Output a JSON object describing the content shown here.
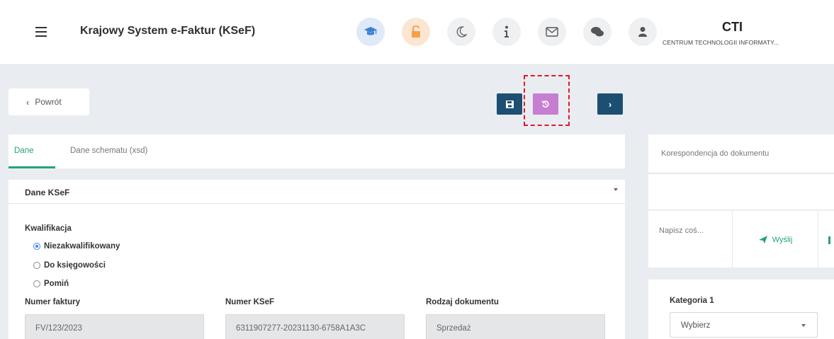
{
  "header": {
    "title": "Krajowy System e-Faktur (KSeF)",
    "icons": [
      "graduation-cap-icon",
      "unlock-icon",
      "moon-icon",
      "info-icon",
      "envelope-icon",
      "comments-icon",
      "user-icon"
    ],
    "brand": {
      "title": "CTI",
      "subtitle": "CENTRUM TECHNOLOGII INFORMATY..."
    }
  },
  "toolbar": {
    "back_label": "Powrót",
    "buttons": [
      "save-icon",
      "restore-icon",
      "next-icon"
    ]
  },
  "tabs": [
    {
      "label": "Dane",
      "active": true
    },
    {
      "label": "Dane schematu (xsd)",
      "active": false
    }
  ],
  "section": {
    "title": "Dane KSeF",
    "qualification_label": "Kwalifikacja",
    "options": [
      {
        "label": "Niezakwalifikowany",
        "selected": true
      },
      {
        "label": "Do księgowości",
        "selected": false
      },
      {
        "label": "Pomiń",
        "selected": false
      }
    ],
    "fields": [
      {
        "label": "Numer faktury",
        "value": "FV/123/2023"
      },
      {
        "label": "Numer KSeF",
        "value": "6311907277-20231130-6758A1A3C"
      },
      {
        "label": "Rodzaj dokumentu",
        "value": "Sprzedaż"
      }
    ]
  },
  "correspondence": {
    "title": "Korespondencja do dokumentu",
    "message_placeholder": "Napisz coś...",
    "send_label": "Wyślij"
  },
  "category": {
    "label": "Kategoria 1",
    "select_value": "Wybierz"
  },
  "colors": {
    "accent": "#23a47a",
    "dark_button": "#1d4f73",
    "pink_button": "#c77dd1",
    "highlight": "#e0192b",
    "radio_selected": "#3b82f6"
  }
}
